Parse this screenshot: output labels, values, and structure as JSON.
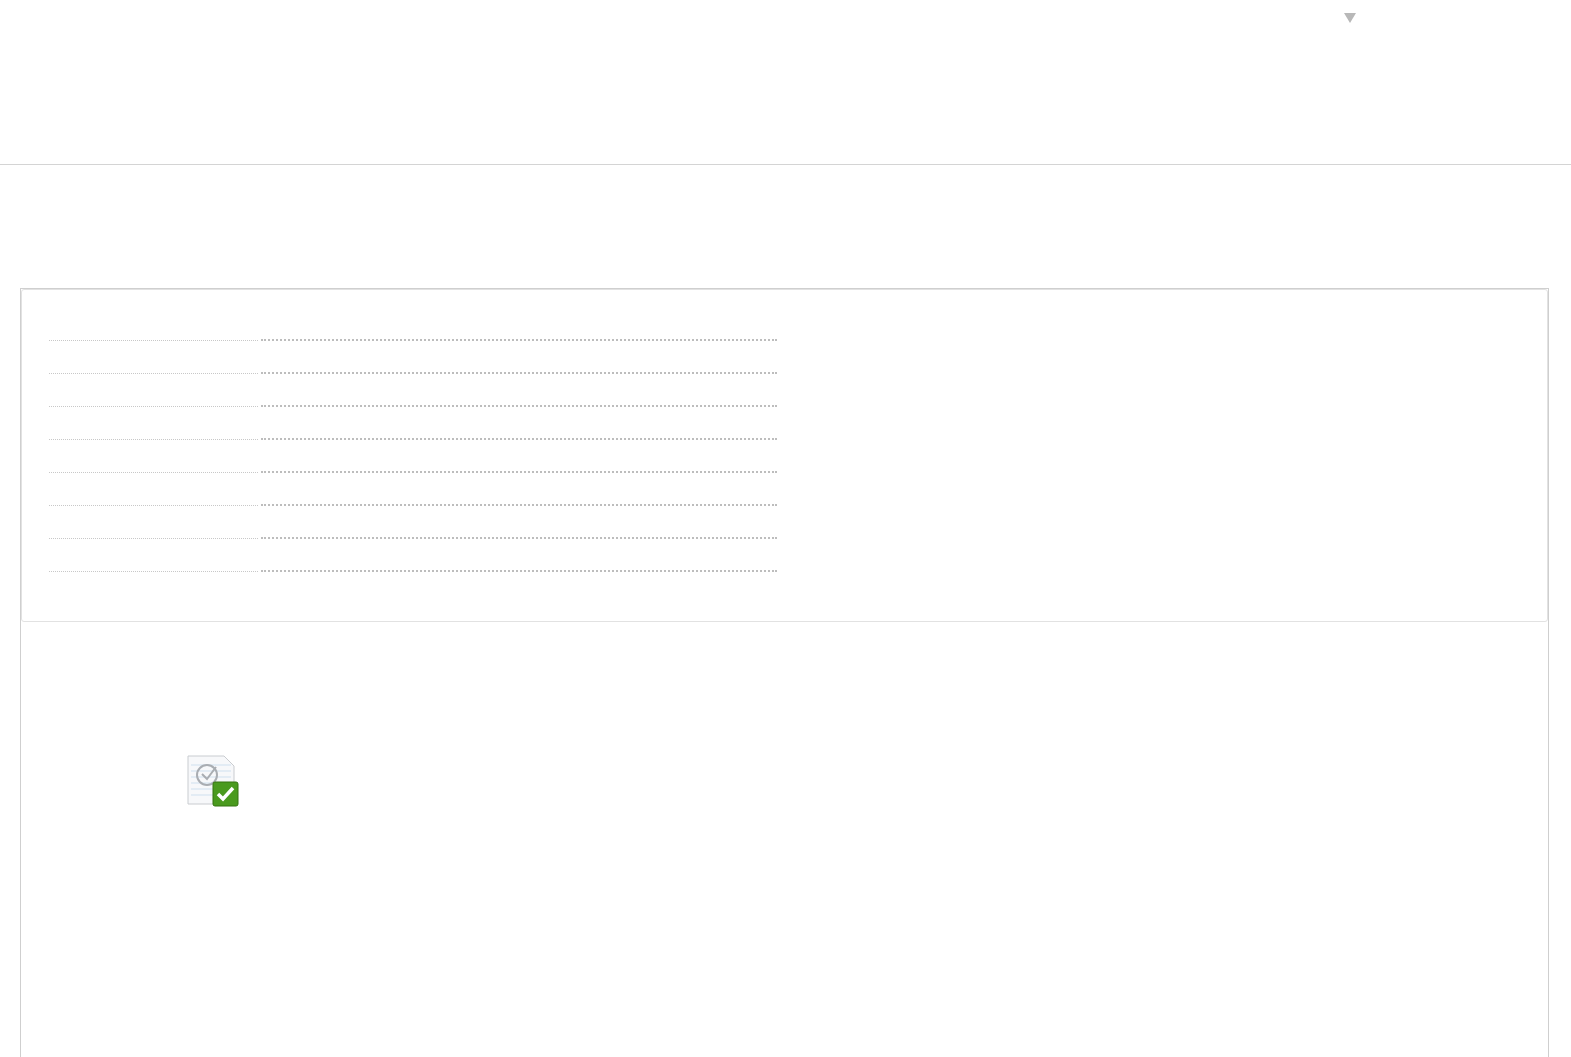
{
  "header": {
    "menu": {
      "expanded": false
    }
  },
  "table": {
    "rows": [
      {
        "kind": "empty"
      },
      {
        "kind": "empty"
      },
      {
        "kind": "empty"
      },
      {
        "kind": "empty"
      },
      {
        "kind": "empty"
      },
      {
        "kind": "empty"
      },
      {
        "kind": "empty"
      },
      {
        "kind": "empty"
      }
    ]
  },
  "status": {
    "kind": "document-check"
  }
}
